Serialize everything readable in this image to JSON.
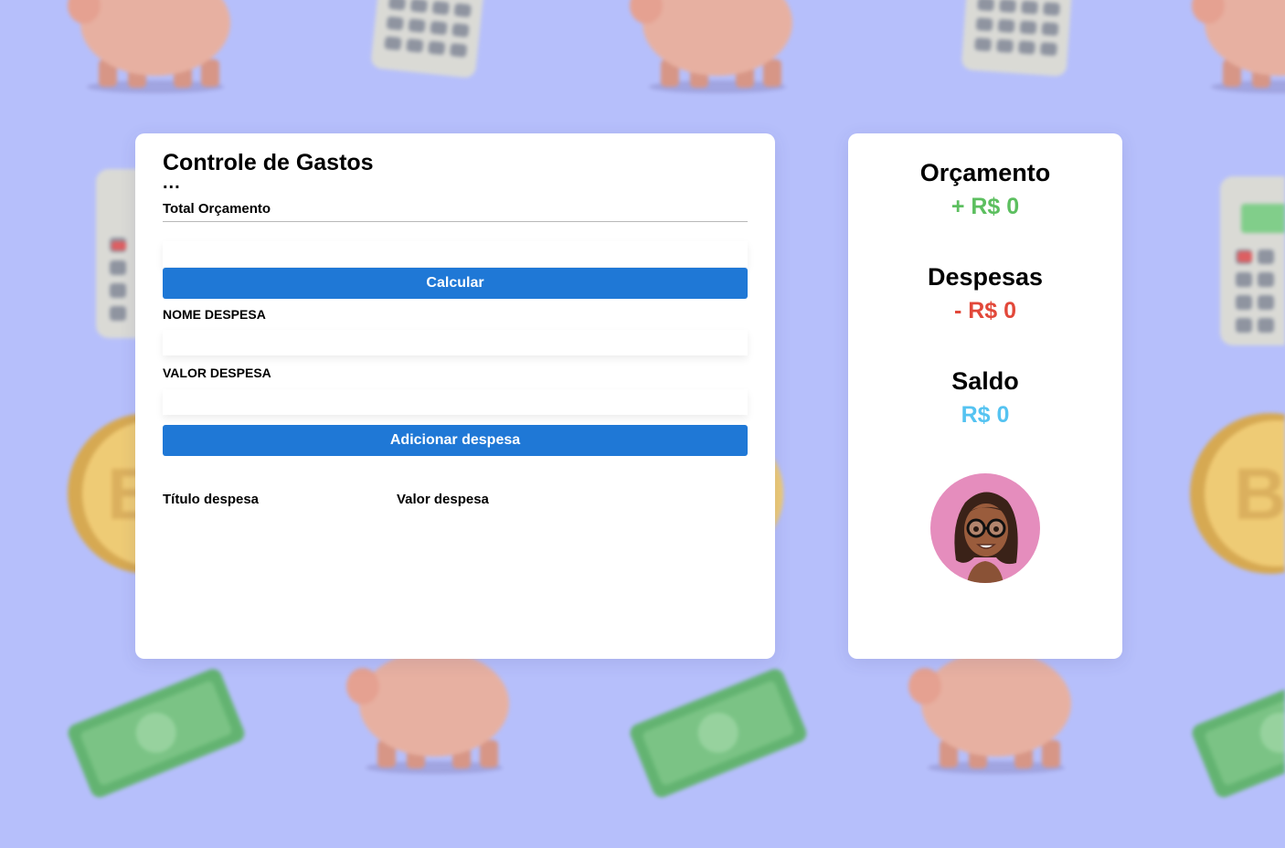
{
  "app": {
    "title": "Controle de Gastos",
    "menu_dots": "..."
  },
  "budget_form": {
    "total_label": "Total Orçamento",
    "total_value": "",
    "total_placeholder": "",
    "calculate_label": "Calcular"
  },
  "expense_form": {
    "name_label": "NOME DESPESA",
    "name_value": "",
    "name_placeholder": "",
    "value_label": "VALOR DESPESA",
    "value_value": "",
    "value_placeholder": "",
    "add_label": "Adicionar despesa"
  },
  "expense_list": {
    "columns": [
      "Título despesa",
      "Valor despesa"
    ],
    "rows": []
  },
  "summary": {
    "budget": {
      "title": "Orçamento",
      "value": "+ R$ 0",
      "color": "#5cbf5f"
    },
    "expenses": {
      "title": "Despesas",
      "value": "- R$ 0",
      "color": "#e2483a"
    },
    "balance": {
      "title": "Saldo",
      "value": "R$ 0",
      "color": "#55c3f1"
    },
    "avatar_icon": "memoji-avatar-icon"
  },
  "colors": {
    "background": "#b6bffb",
    "button": "#1f78d6",
    "avatar_bg": "#e58dbd"
  },
  "background_icons": [
    "piggy-bank-icon",
    "calculator-icon",
    "coin-icon",
    "banknote-icon"
  ]
}
